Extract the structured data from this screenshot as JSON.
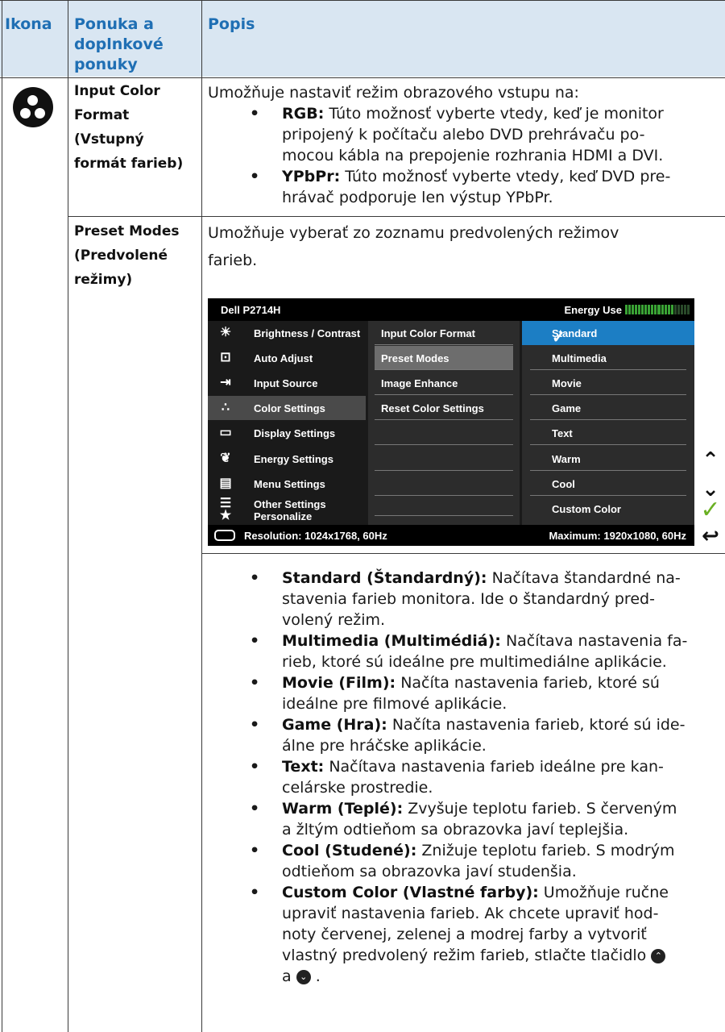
{
  "header": {
    "col1": "Ikona",
    "col2": "Ponuka a doplnkové ponuky",
    "col3": "Popis"
  },
  "input_color": {
    "menu_label": "Input Color Format (Vstupný formát farieb)",
    "menu_lines": [
      "Input Color",
      "Format",
      "(Vstupný",
      "formát farieb)"
    ],
    "intro": "Umožňuje nastaviť režim obrazového vstupu na:",
    "rgb_term": "RGB:",
    "rgb_lines": [
      "Túto možnosť vyberte vtedy, keď je monitor",
      "pripojený k počítaču alebo DVD prehrávaču po-",
      "mocou kábla na prepojenie rozhrania HDMI a DVI."
    ],
    "ypbpr_term": "YPbPr:",
    "ypbpr_lines": [
      "Túto možnosť vyberte vtedy, keď DVD pre-",
      "hrávač podporuje len výstup YPbPr."
    ]
  },
  "preset": {
    "menu_lines": [
      "Preset Modes",
      "(Predvolené",
      "režimy)"
    ],
    "intro_lines": [
      "Umožňuje vyberať zo zoznamu predvolených režimov",
      "farieb."
    ],
    "items": [
      {
        "term": "Standard (Štandardný):",
        "lines": [
          "Načítava štandardné na-",
          "stavenia farieb monitora. Ide o štandardný pred-",
          "volený režim."
        ]
      },
      {
        "term": "Multimedia (Multimédiá):",
        "lines": [
          "Načítava nastavenia fa-",
          "rieb, ktoré sú ideálne pre multimediálne aplikácie."
        ]
      },
      {
        "term": "Movie (Film):",
        "lines": [
          "Načíta nastavenia farieb, ktoré sú",
          "ideálne pre filmové aplikácie."
        ]
      },
      {
        "term": "Game (Hra):",
        "lines": [
          "Načíta nastavenia farieb, ktoré sú ide-",
          "álne pre hráčske aplikácie."
        ]
      },
      {
        "term": "Text:",
        "lines": [
          "Načítava nastavenia farieb ideálne pre kan-",
          "celárske prostredie."
        ]
      },
      {
        "term": "Warm (Teplé):",
        "lines": [
          "Zvyšuje teplotu farieb. S červeným",
          "a žltým odtieňom sa obrazovka javí teplejšia."
        ]
      },
      {
        "term": "Cool (Studené):",
        "lines": [
          "Znižuje teplotu farieb. S modrým",
          "odtieňom sa obrazovka javí studenšia."
        ]
      },
      {
        "term": "Custom Color (Vlastné farby):",
        "lines": [
          "Umožňuje ručne",
          "upraviť nastavenia farieb. Ak chcete upraviť hod-",
          "noty červenej, zelenej a modrej farby a vytvoriť",
          "vlastný predvolený režim farieb, stlačte tlačidlo"
        ],
        "last": "a"
      }
    ]
  },
  "osd": {
    "model": "Dell P2714H",
    "energy": "Energy Use",
    "energy_level": 0.75,
    "left_items": [
      {
        "label": "Brightness / Contrast",
        "icon": "brightness-icon"
      },
      {
        "label": "Auto Adjust",
        "icon": "auto-adjust-icon"
      },
      {
        "label": "Input Source",
        "icon": "input-source-icon"
      },
      {
        "label": "Color Settings",
        "icon": "color-settings-icon"
      },
      {
        "label": "Display Settings",
        "icon": "display-settings-icon"
      },
      {
        "label": "Energy Settings",
        "icon": "energy-settings-icon"
      },
      {
        "label": "Menu Settings",
        "icon": "menu-settings-icon"
      },
      {
        "label": "Other Settings",
        "icon": "other-settings-icon"
      },
      {
        "label": "Personalize",
        "icon": "star-icon"
      }
    ],
    "mid_items": [
      "Input Color Format",
      "Preset Modes",
      "Image Enhance",
      "Reset Color Settings",
      "",
      "",
      "",
      "",
      ""
    ],
    "right_items": [
      "Standard",
      "Multimedia",
      "Movie",
      "Game",
      "Text",
      "Warm",
      "Cool",
      "Custom Color"
    ],
    "resolution": "Resolution: 1024x1768, 60Hz",
    "maximum": "Maximum: 1920x1080, 60Hz"
  },
  "colors": {
    "header_bg": "#d9e6f2",
    "header_text": "#1f6fb4",
    "osd_select": "#1c7ec4",
    "check_green": "#6ab023"
  }
}
